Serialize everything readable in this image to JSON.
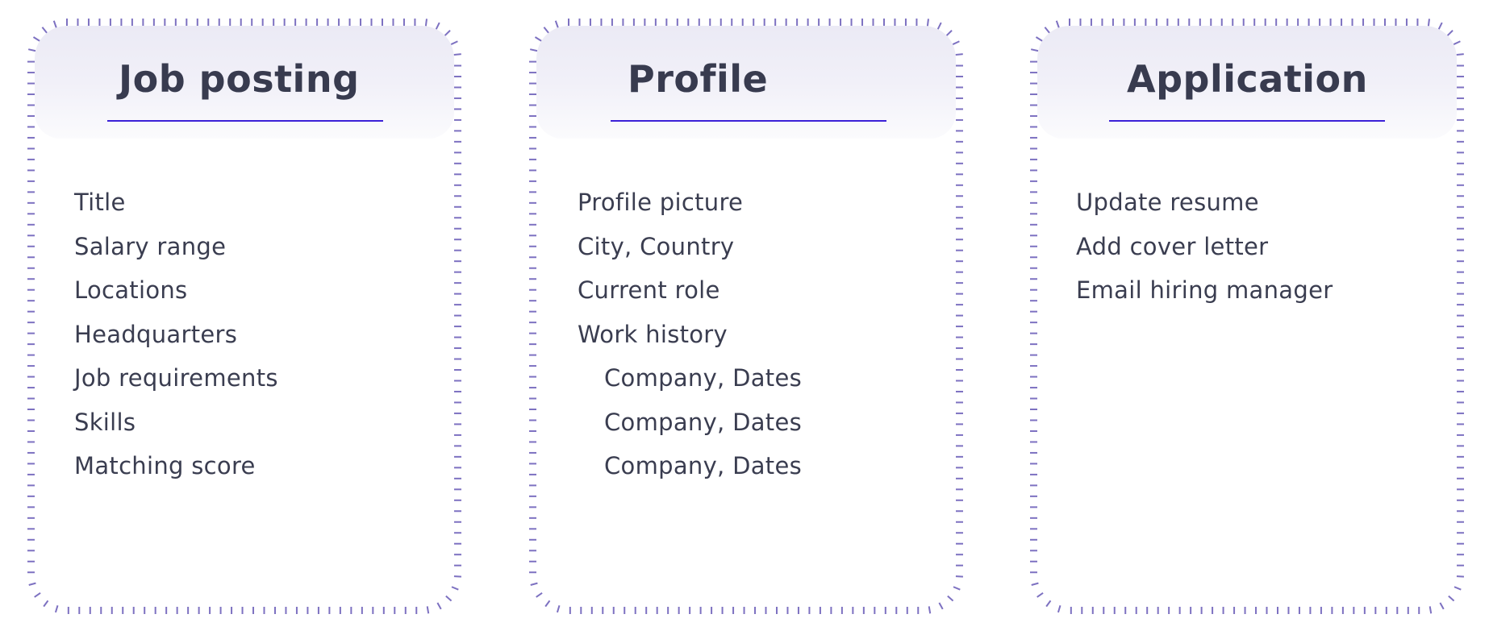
{
  "colors": {
    "tick": "#7d71c1",
    "underline": "#3b20d8",
    "header_bg_top": "#ebeaf5",
    "text": "#3a3d50",
    "title": "#383b4f"
  },
  "cards": [
    {
      "title": "Job posting",
      "items": [
        {
          "label": "Title",
          "indent": false
        },
        {
          "label": "Salary range",
          "indent": false
        },
        {
          "label": "Locations",
          "indent": false
        },
        {
          "label": "Headquarters",
          "indent": false
        },
        {
          "label": "Job requirements",
          "indent": false
        },
        {
          "label": "Skills",
          "indent": false
        },
        {
          "label": "Matching score",
          "indent": false
        }
      ]
    },
    {
      "title": "Profile",
      "items": [
        {
          "label": "Profile picture",
          "indent": false
        },
        {
          "label": "City, Country",
          "indent": false
        },
        {
          "label": "Current role",
          "indent": false
        },
        {
          "label": "Work history",
          "indent": false
        },
        {
          "label": "Company, Dates",
          "indent": true
        },
        {
          "label": "Company, Dates",
          "indent": true
        },
        {
          "label": "Company, Dates",
          "indent": true
        }
      ]
    },
    {
      "title": "Application",
      "items": [
        {
          "label": "Update resume",
          "indent": false
        },
        {
          "label": "Add cover letter",
          "indent": false
        },
        {
          "label": "Email hiring manager",
          "indent": false
        }
      ]
    }
  ]
}
